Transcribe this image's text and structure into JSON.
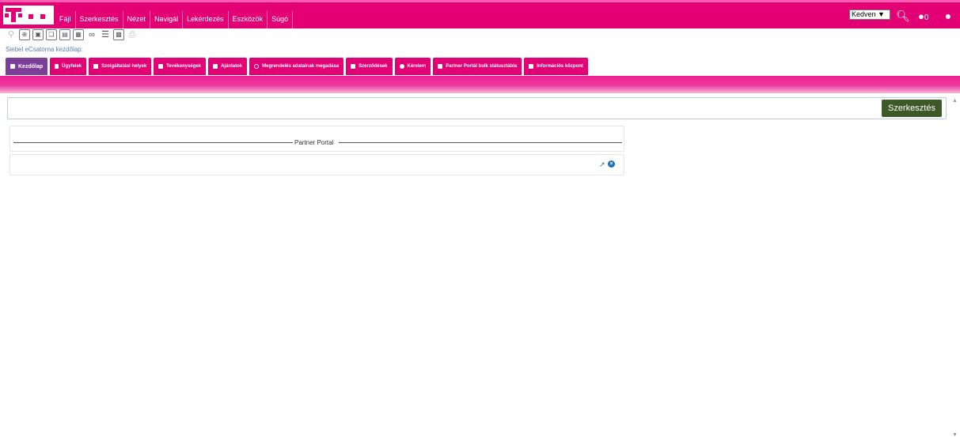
{
  "menu": {
    "items": [
      "Fájl",
      "Szerkesztés",
      "Nézet",
      "Navigál",
      "Lekérdezés",
      "Eszközök",
      "Súgó"
    ]
  },
  "header": {
    "favorites_label": "Kedven ▼",
    "notification_count": "0",
    "icons": [
      "search-icon",
      "chat-icon",
      "user-icon"
    ]
  },
  "toolbar": {
    "buttons": [
      "query-icon",
      "new-record-icon",
      "save-icon",
      "copy-icon",
      "export-icon",
      "delete-icon",
      "link-icon",
      "list-icon",
      "clipboard-icon",
      "print-icon"
    ]
  },
  "breadcrumb": "Siebel eCsatorna kezdőlap:",
  "tabs": [
    "Kezdőlap",
    "Ügyfelek",
    "Szolgáltatási helyek",
    "Tevékenységek",
    "Ajánlatok",
    "Megrendelés adatainak megadása",
    "Szerződések",
    "Kérelem",
    "Partner Portál bulk státusztábla",
    "Információs központ"
  ],
  "main": {
    "edit_button": "Szerkesztés",
    "portal_title": "Partner Portal"
  },
  "colors": {
    "brand": "#e20074",
    "active_tab": "#7b3f98",
    "edit_button": "#3e5828",
    "link": "#5a7fb0"
  }
}
